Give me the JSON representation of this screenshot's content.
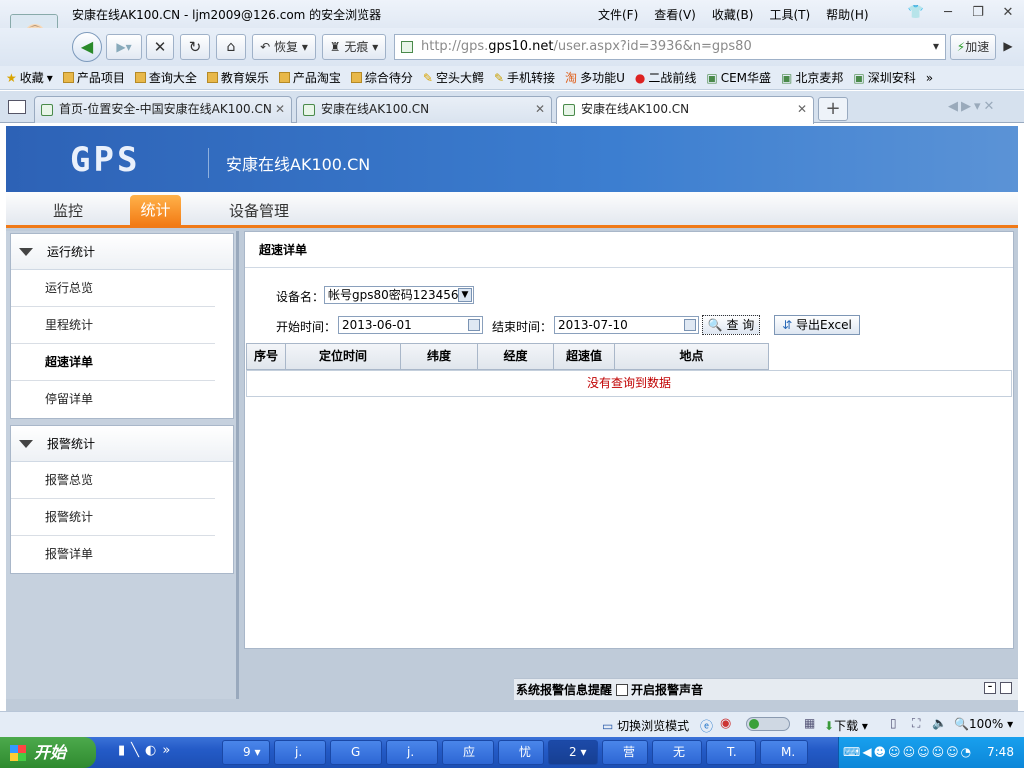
{
  "browser": {
    "window_title": "安康在线AK100.CN - ljm2009@126.com 的安全浏览器",
    "menu": [
      "文件(F)",
      "查看(V)",
      "收藏(B)",
      "工具(T)",
      "帮助(H)"
    ],
    "nav": {
      "restore_label": "恢复",
      "incognito_label": "无痕",
      "speed_label": "加速"
    },
    "address": {
      "prefix": "http://gps.",
      "host": "gps10.net",
      "path": "/user.aspx?id=3936&n=gps80"
    },
    "bookmarks": [
      "收藏",
      "产品项目",
      "查询大全",
      "教育娱乐",
      "产品淘宝",
      "综合待分",
      "空头大鳄",
      "手机转接",
      "多功能U",
      "二战前线",
      "CEM华盛",
      "北京麦邦",
      "深圳安科"
    ],
    "tabs": [
      {
        "label": "首页-位置安全-中国安康在线AK100.CN"
      },
      {
        "label": "安康在线AK100.CN"
      },
      {
        "label": "安康在线AK100.CN"
      }
    ]
  },
  "header": {
    "logo": "GPS",
    "site_name": "安康在线AK100.CN"
  },
  "main_nav": {
    "monitor": "监控",
    "stats": "统计",
    "devices": "设备管理"
  },
  "sidebar": {
    "run_group": {
      "title": "运行统计",
      "items": [
        "运行总览",
        "里程统计",
        "超速详单",
        "停留详单"
      ]
    },
    "alarm_group": {
      "title": "报警统计",
      "items": [
        "报警总览",
        "报警统计",
        "报警详单"
      ]
    }
  },
  "content": {
    "title": "超速详单",
    "device_label": "设备名：",
    "device_value": "帐号gps80密码123456",
    "start_label": "开始时间：",
    "start_value": "2013-06-01",
    "end_label": "结束时间：",
    "end_value": "2013-07-10",
    "query_btn": "查 询",
    "export_btn": "导出Excel",
    "columns": [
      "序号",
      "定位时间",
      "纬度",
      "经度",
      "超速值",
      "地点"
    ],
    "empty_msg": "没有查询到数据"
  },
  "alarm_bar": {
    "label": "系统报警信息提醒",
    "sound_label": "开启报警声音"
  },
  "statusbar": {
    "switch_mode": "切换浏览模式",
    "download": "下载",
    "zoom": "100%"
  },
  "taskbar": {
    "start": "开始",
    "items": [
      "9",
      "j.",
      "G",
      "j.",
      "应",
      "忧",
      "2",
      "营",
      "无",
      "T.",
      "M."
    ],
    "clock": "7:48"
  },
  "colors": {
    "header_blue": "#2d62b6",
    "accent_orange": "#f07a18",
    "empty_red": "#c00000"
  }
}
